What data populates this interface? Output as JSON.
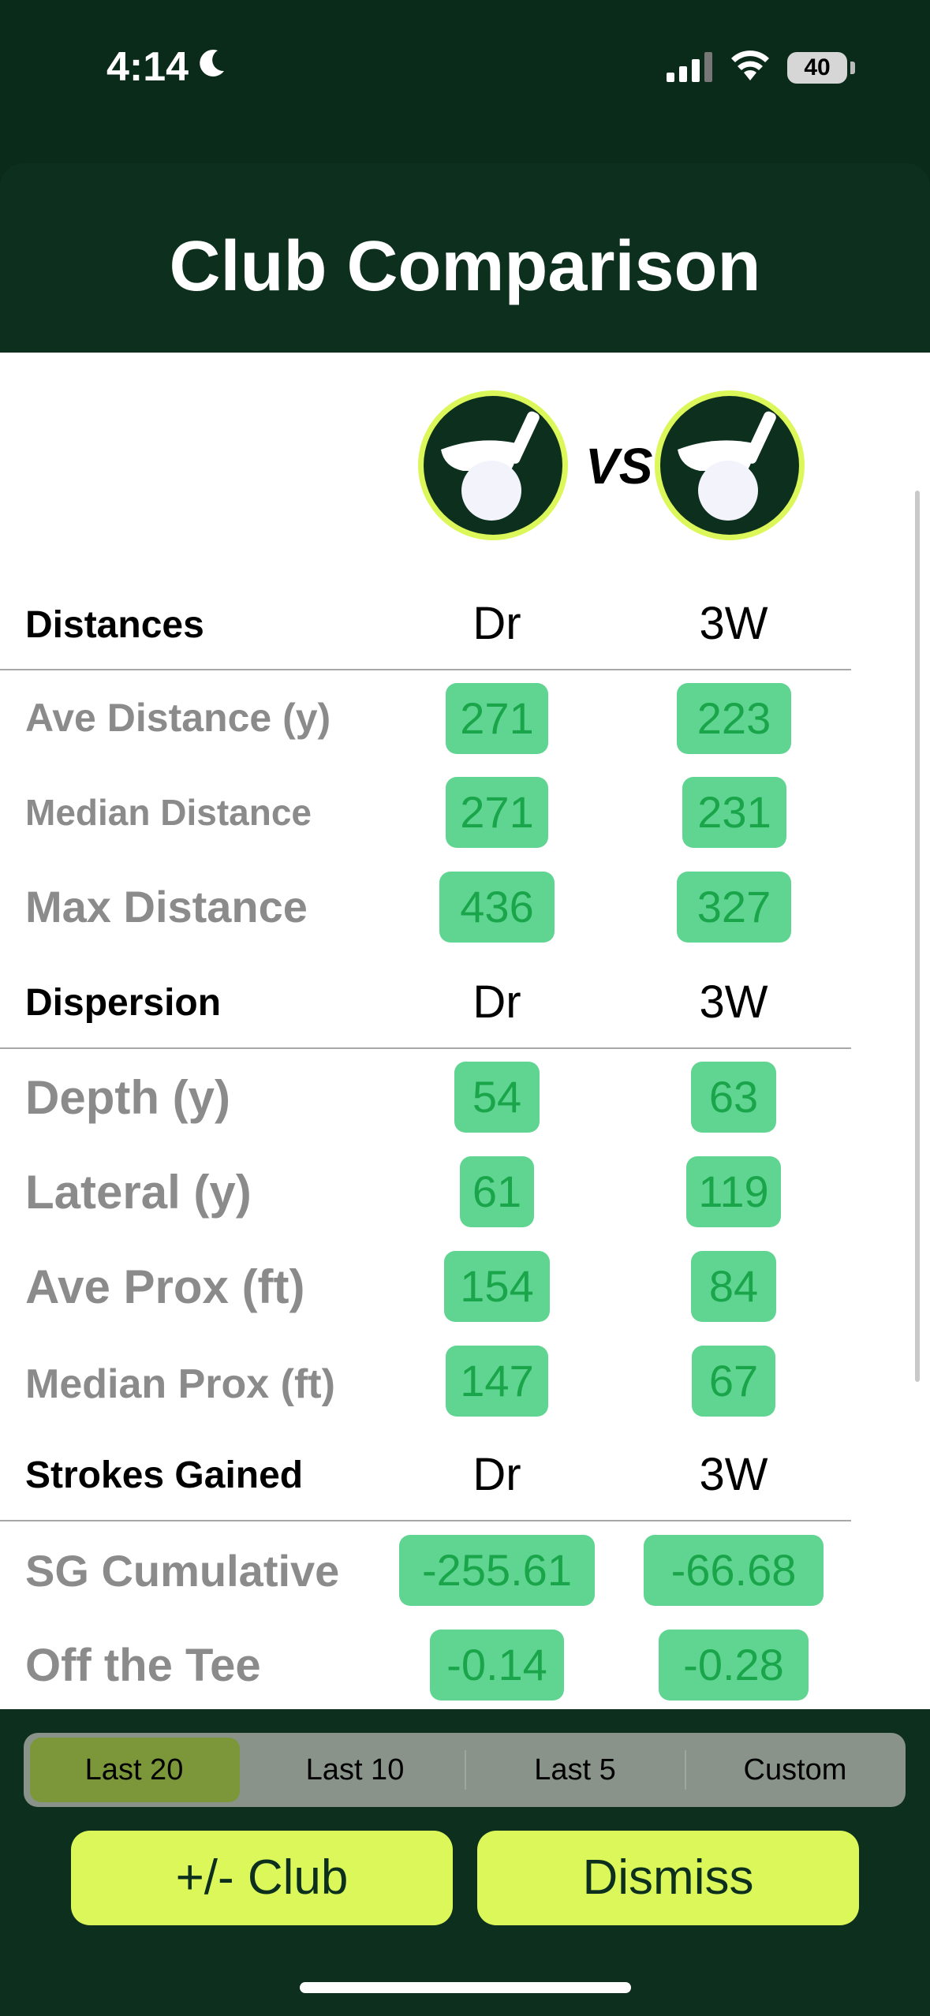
{
  "status": {
    "time": "4:14",
    "battery": "40"
  },
  "header": {
    "title": "Club Comparison"
  },
  "compare": {
    "vs": "VS"
  },
  "clubs": [
    "Dr",
    "3W"
  ],
  "sections": [
    {
      "title": "Distances",
      "rows": [
        {
          "label": "Ave Distance (y)",
          "values": [
            "271",
            "223"
          ]
        },
        {
          "label": "Median Distance",
          "values": [
            "271",
            "231"
          ]
        },
        {
          "label": "Max Distance",
          "values": [
            "436",
            "327"
          ]
        }
      ]
    },
    {
      "title": "Dispersion",
      "rows": [
        {
          "label": "Depth (y)",
          "values": [
            "54",
            "63"
          ]
        },
        {
          "label": "Lateral (y)",
          "values": [
            "61",
            "119"
          ]
        },
        {
          "label": "Ave Prox (ft)",
          "values": [
            "154",
            "84"
          ]
        },
        {
          "label": "Median Prox (ft)",
          "values": [
            "147",
            "67"
          ]
        }
      ]
    },
    {
      "title": "Strokes Gained",
      "rows": [
        {
          "label": "SG Cumulative",
          "values": [
            "-255.61",
            "-66.68"
          ]
        },
        {
          "label": "Off the Tee",
          "values": [
            "-0.14",
            "-0.28"
          ]
        }
      ]
    }
  ],
  "filters": {
    "options": [
      "Last 20",
      "Last 10",
      "Last 5",
      "Custom"
    ],
    "selected": "Last 20"
  },
  "actions": {
    "club": "+/- Club",
    "dismiss": "Dismiss"
  },
  "colors": {
    "accent": "#dcf75a",
    "dark": "#0c2f1e",
    "badge": "#5fd591",
    "badge_text": "#1aa54a"
  }
}
